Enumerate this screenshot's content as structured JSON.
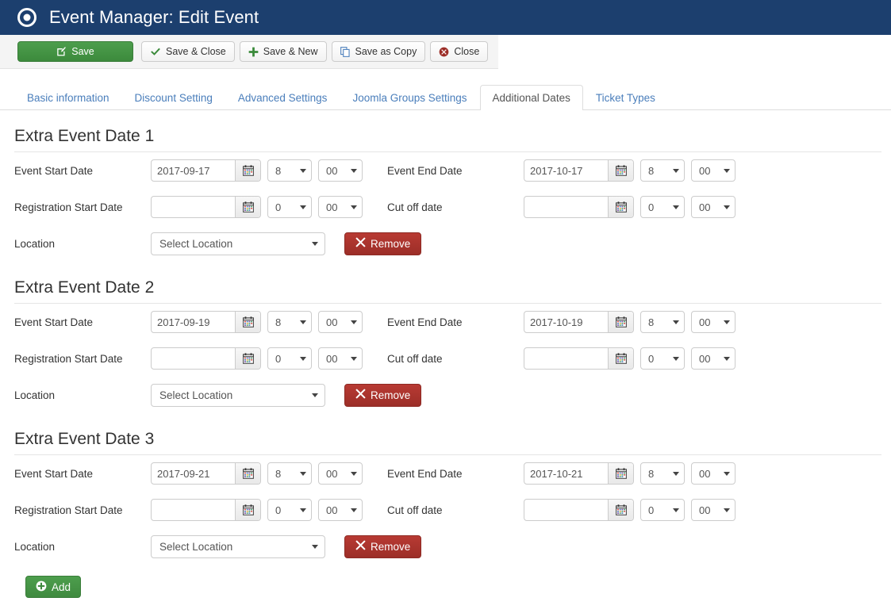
{
  "header": {
    "title": "Event Manager: Edit Event",
    "icon": "record-circle-icon"
  },
  "toolbar": {
    "buttons": [
      {
        "label": "Save",
        "icon": "edit-pencil-icon",
        "style": "primary"
      },
      {
        "label": "Save & Close",
        "icon": "check-icon",
        "style": "default"
      },
      {
        "label": "Save & New",
        "icon": "plus-icon",
        "style": "default"
      },
      {
        "label": "Save as Copy",
        "icon": "copy-icon",
        "style": "default"
      },
      {
        "label": "Close",
        "icon": "cancel-circle-icon",
        "style": "default"
      }
    ]
  },
  "tabs": [
    {
      "label": "Basic information",
      "active": false
    },
    {
      "label": "Discount Setting",
      "active": false
    },
    {
      "label": "Advanced Settings",
      "active": false
    },
    {
      "label": "Joomla Groups Settings",
      "active": false
    },
    {
      "label": "Additional Dates",
      "active": true
    },
    {
      "label": "Ticket Types",
      "active": false
    }
  ],
  "labels": {
    "event_start_date": "Event Start Date",
    "event_end_date": "Event End Date",
    "registration_start_date": "Registration Start Date",
    "cut_off_date": "Cut off date",
    "location": "Location",
    "remove": "Remove",
    "add": "Add",
    "date_placeholder": ""
  },
  "sections": [
    {
      "title": "Extra Event Date 1",
      "event_start": {
        "date": "2017-09-17",
        "hour": "8",
        "minute": "00"
      },
      "event_end": {
        "date": "2017-10-17",
        "hour": "8",
        "minute": "00"
      },
      "registration_start": {
        "date": "",
        "hour": "0",
        "minute": "00"
      },
      "cut_off": {
        "date": "",
        "hour": "0",
        "minute": "00"
      },
      "location": "Select Location"
    },
    {
      "title": "Extra Event Date 2",
      "event_start": {
        "date": "2017-09-19",
        "hour": "8",
        "minute": "00"
      },
      "event_end": {
        "date": "2017-10-19",
        "hour": "8",
        "minute": "00"
      },
      "registration_start": {
        "date": "",
        "hour": "0",
        "minute": "00"
      },
      "cut_off": {
        "date": "",
        "hour": "0",
        "minute": "00"
      },
      "location": "Select Location"
    },
    {
      "title": "Extra Event Date 3",
      "event_start": {
        "date": "2017-09-21",
        "hour": "8",
        "minute": "00"
      },
      "event_end": {
        "date": "2017-10-21",
        "hour": "8",
        "minute": "00"
      },
      "registration_start": {
        "date": "",
        "hour": "0",
        "minute": "00"
      },
      "cut_off": {
        "date": "",
        "hour": "0",
        "minute": "00"
      },
      "location": "Select Location"
    }
  ],
  "colors": {
    "header_bg": "#1c3f6e",
    "primary_green": "#3c8a3c",
    "danger_red": "#9c2e28",
    "link_blue": "#4a7ebb"
  }
}
